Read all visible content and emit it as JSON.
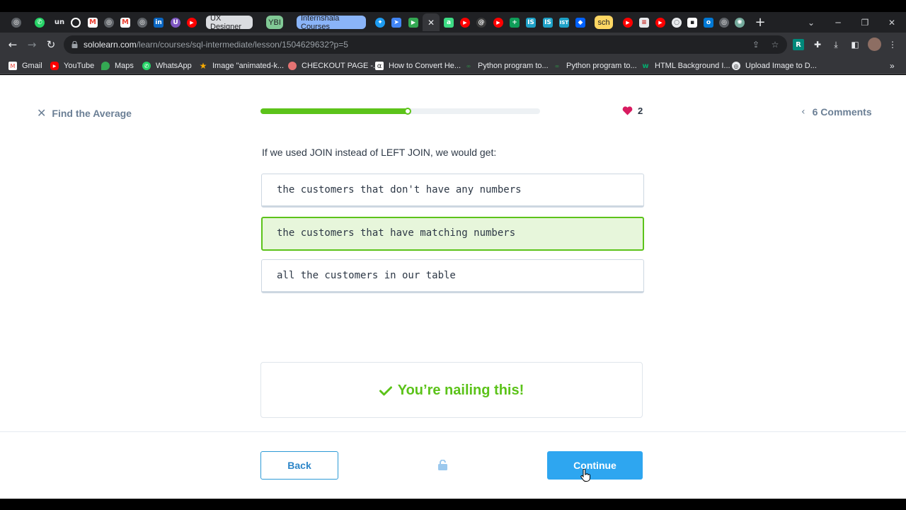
{
  "browser": {
    "tabs": [
      {
        "icon": "globe-icon"
      },
      {
        "icon": "whatsapp-icon"
      },
      {
        "icon": "unacademy-icon",
        "text": "un"
      },
      {
        "icon": "github-icon"
      },
      {
        "icon": "gmail-icon"
      },
      {
        "icon": "globe-icon"
      },
      {
        "icon": "gmail-icon"
      },
      {
        "icon": "globe-icon"
      },
      {
        "icon": "linkedin-icon",
        "text": "in"
      },
      {
        "icon": "proton-icon"
      },
      {
        "icon": "youtube-icon"
      }
    ],
    "tab_groups": [
      {
        "label": "UX Designer",
        "bg": "#dadce0",
        "fg": "#202124"
      },
      {
        "label": "YBI",
        "bg": "#81c995",
        "fg": "#202124"
      },
      {
        "label": "Internshala Courses",
        "bg": "#8ab4f8",
        "fg": "#202124"
      },
      {
        "label": "sch",
        "bg": "#fdd663",
        "fg": "#202124"
      }
    ],
    "url_host": "sololearn.com",
    "url_path": "/learn/courses/sql-intermediate/lesson/1504629632?p=5",
    "bookmarks": [
      {
        "label": "Gmail",
        "icon": "gmail-icon",
        "color": "#ea4335"
      },
      {
        "label": "YouTube",
        "icon": "youtube-icon",
        "color": "#ff0000"
      },
      {
        "label": "Maps",
        "icon": "maps-icon",
        "color": "#34a853"
      },
      {
        "label": "WhatsApp",
        "icon": "whatsapp-icon",
        "color": "#25d366"
      },
      {
        "label": "Image \"animated-k...",
        "icon": "star-icon",
        "color": "#f9ab00"
      },
      {
        "label": "CHECKOUT PAGE -...",
        "icon": "lips-icon",
        "color": "#e57373"
      },
      {
        "label": "How to Convert He...",
        "icon": "alpha-icon",
        "color": "#202124"
      },
      {
        "label": "Python program to...",
        "icon": "gfg-icon",
        "color": "#2f8d46"
      },
      {
        "label": "Python program to...",
        "icon": "gfg-icon",
        "color": "#2f8d46"
      },
      {
        "label": "HTML Background I...",
        "icon": "w-icon",
        "color": "#04aa6d"
      },
      {
        "label": "Upload Image to D...",
        "icon": "globe-icon",
        "color": "#9aa0a6"
      }
    ]
  },
  "lesson": {
    "close_label": "Find the Average",
    "progress": 0.53,
    "lives": "2",
    "comments_label": "6 Comments",
    "question": "If we used JOIN instead of LEFT JOIN, we would get:",
    "options": [
      {
        "text": "the customers that don't have any numbers",
        "selected": false
      },
      {
        "text": "the customers that have matching numbers",
        "selected": true
      },
      {
        "text": "all the customers in our table",
        "selected": false
      }
    ],
    "feedback": "You’re nailing this!",
    "back_label": "Back",
    "continue_label": "Continue"
  },
  "colors": {
    "accent_green": "#5cc31a",
    "accent_blue": "#2ea6f0",
    "heart": "#d81b60"
  }
}
